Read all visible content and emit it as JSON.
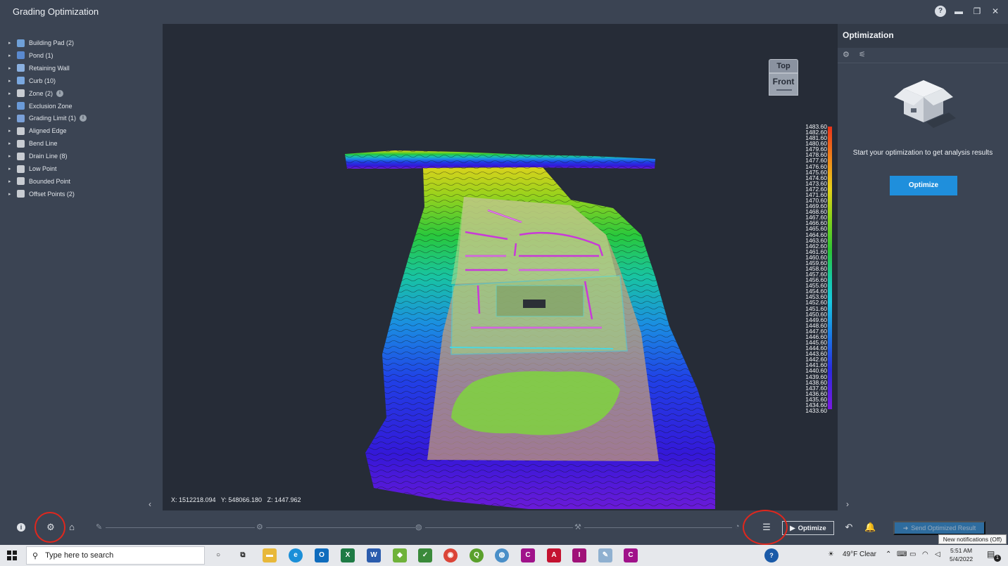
{
  "window": {
    "title": "Grading Optimization"
  },
  "tree": [
    {
      "label": "Building Pad (2)",
      "icon": "building-pad-icon",
      "info": false
    },
    {
      "label": "Pond (1)",
      "icon": "pond-icon",
      "info": false
    },
    {
      "label": "Retaining Wall",
      "icon": "retaining-wall-icon",
      "info": false
    },
    {
      "label": "Curb (10)",
      "icon": "curb-icon",
      "info": false
    },
    {
      "label": "Zone (2)",
      "icon": "zone-icon",
      "info": true
    },
    {
      "label": "Exclusion Zone",
      "icon": "exclusion-zone-icon",
      "info": false
    },
    {
      "label": "Grading Limit (1)",
      "icon": "grading-limit-icon",
      "info": true
    },
    {
      "label": "Aligned Edge",
      "icon": "aligned-edge-icon",
      "info": false
    },
    {
      "label": "Bend Line",
      "icon": "bend-line-icon",
      "info": false
    },
    {
      "label": "Drain Line (8)",
      "icon": "drain-line-icon",
      "info": false
    },
    {
      "label": "Low Point",
      "icon": "low-point-icon",
      "info": false
    },
    {
      "label": "Bounded Point",
      "icon": "bounded-point-icon",
      "info": false
    },
    {
      "label": "Offset Points (2)",
      "icon": "offset-points-icon",
      "info": false
    }
  ],
  "viewport": {
    "viewcube_top": "Top",
    "viewcube_front": "Front",
    "coords_x": "X: 1512218.094",
    "coords_y": "Y: 548066.180",
    "coords_z": "Z: 1447.962",
    "scale_labels": [
      "1483.60",
      "1482.60",
      "1481.60",
      "1480.60",
      "1479.60",
      "1478.60",
      "1477.60",
      "1476.60",
      "1475.60",
      "1474.60",
      "1473.60",
      "1472.60",
      "1471.60",
      "1470.60",
      "1469.60",
      "1468.60",
      "1467.60",
      "1466.60",
      "1465.60",
      "1464.60",
      "1463.60",
      "1462.60",
      "1461.60",
      "1460.60",
      "1459.60",
      "1458.60",
      "1457.60",
      "1456.60",
      "1455.60",
      "1454.60",
      "1453.60",
      "1452.60",
      "1451.60",
      "1450.60",
      "1449.60",
      "1448.60",
      "1447.60",
      "1446.60",
      "1445.60",
      "1444.60",
      "1443.60",
      "1442.60",
      "1441.60",
      "1440.60",
      "1439.60",
      "1438.60",
      "1437.60",
      "1436.60",
      "1435.60",
      "1434.60",
      "1433.60"
    ]
  },
  "right_panel": {
    "title": "Optimization",
    "message": "Start your optimization to get analysis results",
    "optimize_button": "Optimize"
  },
  "toolbar": {
    "optimize_label": "Optimize",
    "send_label": "Send Optimized Result",
    "tooltip": "New notifications (Off)"
  },
  "taskbar": {
    "search_placeholder": "Type here to search",
    "weather": "49°F  Clear",
    "time": "5:51 AM",
    "date": "5/4/2022",
    "notification_count": "1"
  },
  "colors": {
    "panel_bg": "#3b4453",
    "viewport_bg": "#262c37",
    "accent_blue": "#1f8fdc",
    "annotation_red": "#e0271d"
  }
}
